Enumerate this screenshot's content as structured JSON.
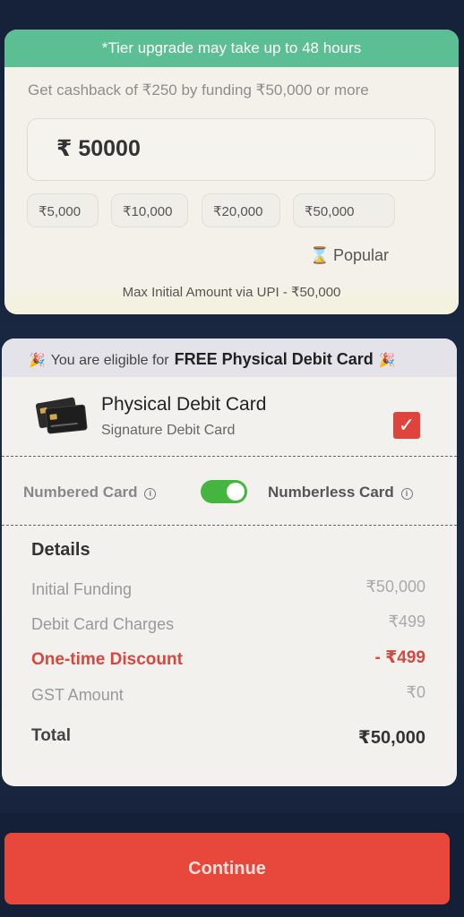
{
  "top_card": {
    "banner": "*Tier upgrade may take up to 48 hours",
    "cashback_text": "Get cashback of ₹250 by funding ₹50,000 or more",
    "amount_value": "₹ 50000",
    "chips": [
      "₹5,000",
      "₹10,000",
      "₹20,000",
      "₹50,000"
    ],
    "popular_label": "Popular",
    "upi_note": "Max Initial Amount via UPI - ₹50,000"
  },
  "card_section": {
    "eligible_prefix": "You are eligible for",
    "eligible_strong": "FREE Physical Debit Card",
    "card_title": "Physical Debit Card",
    "card_subtitle": "Signature Debit Card",
    "checkbox_checked": true,
    "numbered_label": "Numbered Card",
    "numberless_label": "Numberless Card",
    "toggle_on": true
  },
  "details": {
    "title": "Details",
    "rows": [
      {
        "label": "Initial Funding",
        "value": "₹50,000"
      },
      {
        "label": "Debit Card Charges",
        "value": "₹499"
      },
      {
        "label": "One-time Discount",
        "value": "- ₹499"
      },
      {
        "label": "GST Amount",
        "value": "₹0"
      },
      {
        "label": "Total",
        "value": "₹50,000"
      }
    ]
  },
  "continue_label": "Continue",
  "colors": {
    "accent_green": "#5bbf93",
    "toggle_green": "#44b53f",
    "primary_red": "#e8473b",
    "background_navy": "#15223a"
  }
}
